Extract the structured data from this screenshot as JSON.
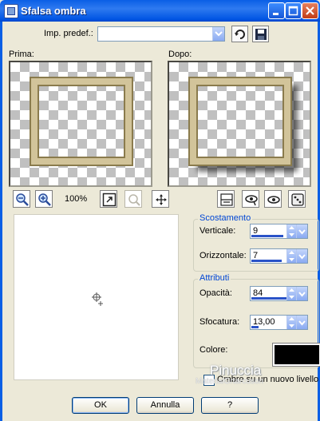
{
  "window": {
    "title": "Sfalsa ombra"
  },
  "preset": {
    "label": "Imp. predef.:",
    "value": ""
  },
  "preview": {
    "before_label": "Prima:",
    "after_label": "Dopo:"
  },
  "zoom": {
    "level": "100%"
  },
  "offset_group": {
    "title": "Scostamento",
    "vertical_label": "Verticale:",
    "vertical_value": "9",
    "horizontal_label": "Orizzontale:",
    "horizontal_value": "7"
  },
  "attributes_group": {
    "title": "Attributi",
    "opacity_label": "Opacità:",
    "opacity_value": "84",
    "blur_label": "Sfocatura:",
    "blur_value": "13,00",
    "color_label": "Colore:",
    "color_value": "#000000"
  },
  "new_layer": {
    "label": "Ombre su un nuovo livello",
    "checked": false
  },
  "watermark": {
    "name": "Pinuccia",
    "site": "MaterialGrtarcuson"
  },
  "buttons": {
    "ok": "OK",
    "cancel": "Annulla",
    "help": "?"
  }
}
